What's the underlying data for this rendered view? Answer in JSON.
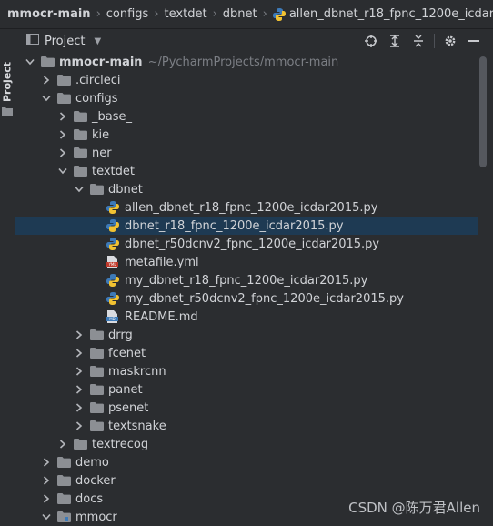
{
  "breadcrumb": {
    "items": [
      "mmocr-main",
      "configs",
      "textdet",
      "dbnet",
      "allen_dbnet_r18_fpnc_1200e_icdar2015.py"
    ]
  },
  "strip": {
    "label": "Project"
  },
  "panel": {
    "title": "Project"
  },
  "root": {
    "name": "mmocr-main",
    "path": "~/PycharmProjects/mmocr-main"
  },
  "tree": [
    {
      "label": "mmocr-main",
      "depth": 0,
      "expanded": true,
      "type": "folder",
      "root": true
    },
    {
      "label": ".circleci",
      "depth": 1,
      "expanded": false,
      "type": "folder"
    },
    {
      "label": "configs",
      "depth": 1,
      "expanded": true,
      "type": "folder"
    },
    {
      "label": "_base_",
      "depth": 2,
      "expanded": false,
      "type": "folder"
    },
    {
      "label": "kie",
      "depth": 2,
      "expanded": false,
      "type": "folder"
    },
    {
      "label": "ner",
      "depth": 2,
      "expanded": false,
      "type": "folder"
    },
    {
      "label": "textdet",
      "depth": 2,
      "expanded": true,
      "type": "folder"
    },
    {
      "label": "dbnet",
      "depth": 3,
      "expanded": true,
      "type": "folder"
    },
    {
      "label": "allen_dbnet_r18_fpnc_1200e_icdar2015.py",
      "depth": 4,
      "type": "py"
    },
    {
      "label": "dbnet_r18_fpnc_1200e_icdar2015.py",
      "depth": 4,
      "type": "py",
      "selected": true
    },
    {
      "label": "dbnet_r50dcnv2_fpnc_1200e_icdar2015.py",
      "depth": 4,
      "type": "py"
    },
    {
      "label": "metafile.yml",
      "depth": 4,
      "type": "yml"
    },
    {
      "label": "my_dbnet_r18_fpnc_1200e_icdar2015.py",
      "depth": 4,
      "type": "py"
    },
    {
      "label": "my_dbnet_r50dcnv2_fpnc_1200e_icdar2015.py",
      "depth": 4,
      "type": "py"
    },
    {
      "label": "README.md",
      "depth": 4,
      "type": "md"
    },
    {
      "label": "drrg",
      "depth": 3,
      "expanded": false,
      "type": "folder"
    },
    {
      "label": "fcenet",
      "depth": 3,
      "expanded": false,
      "type": "folder"
    },
    {
      "label": "maskrcnn",
      "depth": 3,
      "expanded": false,
      "type": "folder"
    },
    {
      "label": "panet",
      "depth": 3,
      "expanded": false,
      "type": "folder"
    },
    {
      "label": "psenet",
      "depth": 3,
      "expanded": false,
      "type": "folder"
    },
    {
      "label": "textsnake",
      "depth": 3,
      "expanded": false,
      "type": "folder"
    },
    {
      "label": "textrecog",
      "depth": 2,
      "expanded": false,
      "type": "folder"
    },
    {
      "label": "demo",
      "depth": 1,
      "expanded": false,
      "type": "folder"
    },
    {
      "label": "docker",
      "depth": 1,
      "expanded": false,
      "type": "folder"
    },
    {
      "label": "docs",
      "depth": 1,
      "expanded": false,
      "type": "folder"
    },
    {
      "label": "mmocr",
      "depth": 1,
      "expanded": true,
      "type": "folder-module"
    }
  ],
  "watermark": "CSDN @陈万君Allen",
  "colors": {
    "selection": "#1e3a53",
    "folder": "#8c8f94",
    "py_blue": "#3d7ab8",
    "py_yellow": "#f1c232"
  }
}
